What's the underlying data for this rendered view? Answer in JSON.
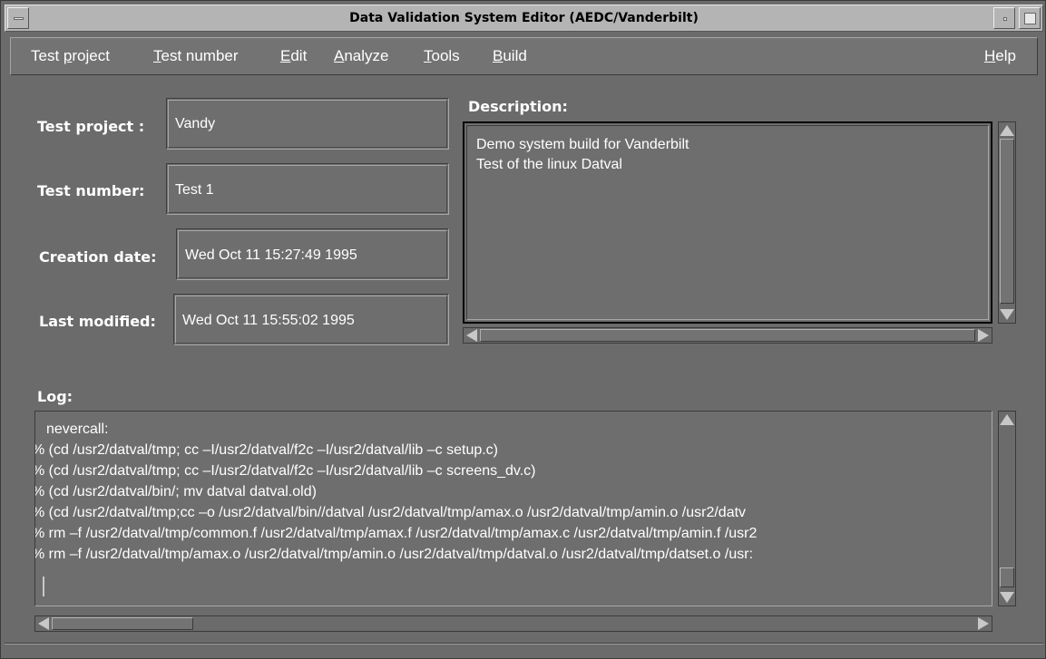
{
  "window": {
    "title": "Data Validation System Editor (AEDC/Vanderbilt)"
  },
  "menubar": {
    "items": [
      {
        "pre": "Test ",
        "mn": "p",
        "post": "roject"
      },
      {
        "pre": "",
        "mn": "T",
        "post": "est number"
      },
      {
        "pre": "",
        "mn": "E",
        "post": "dit"
      },
      {
        "pre": "",
        "mn": "A",
        "post": "nalyze"
      },
      {
        "pre": "",
        "mn": "T",
        "post": "ools"
      },
      {
        "pre": "",
        "mn": "B",
        "post": "uild"
      }
    ],
    "help": {
      "pre": "",
      "mn": "H",
      "post": "elp"
    }
  },
  "form": {
    "test_project_label": "Test project :",
    "test_project_value": "Vandy",
    "test_number_label": "Test number:",
    "test_number_value": "Test 1",
    "creation_date_label": "Creation date:",
    "creation_date_value": "Wed Oct 11 15:27:49 1995",
    "last_modified_label": "Last modified:",
    "last_modified_value": "Wed Oct 11 15:55:02 1995"
  },
  "description": {
    "label": "Description:",
    "lines": [
      "Demo system build for Vanderbilt",
      "Test of the linux Datval"
    ]
  },
  "log": {
    "label": "Log:",
    "lines": [
      "   nevercall:",
      "% (cd /usr2/datval/tmp; cc –I/usr2/datval/f2c –I/usr2/datval/lib –c setup.c)",
      "% (cd /usr2/datval/tmp; cc –I/usr2/datval/f2c –I/usr2/datval/lib –c screens_dv.c)",
      "% (cd /usr2/datval/bin/; mv datval datval.old)",
      "% (cd /usr2/datval/tmp;cc –o /usr2/datval/bin//datval /usr2/datval/tmp/amax.o /usr2/datval/tmp/amin.o /usr2/datv",
      "% rm –f /usr2/datval/tmp/common.f /usr2/datval/tmp/amax.f /usr2/datval/tmp/amax.c /usr2/datval/tmp/amin.f /usr2",
      "% rm –f /usr2/datval/tmp/amax.o /usr2/datval/tmp/amin.o /usr2/datval/tmp/datval.o /usr2/datval/tmp/datset.o /usr:"
    ]
  }
}
